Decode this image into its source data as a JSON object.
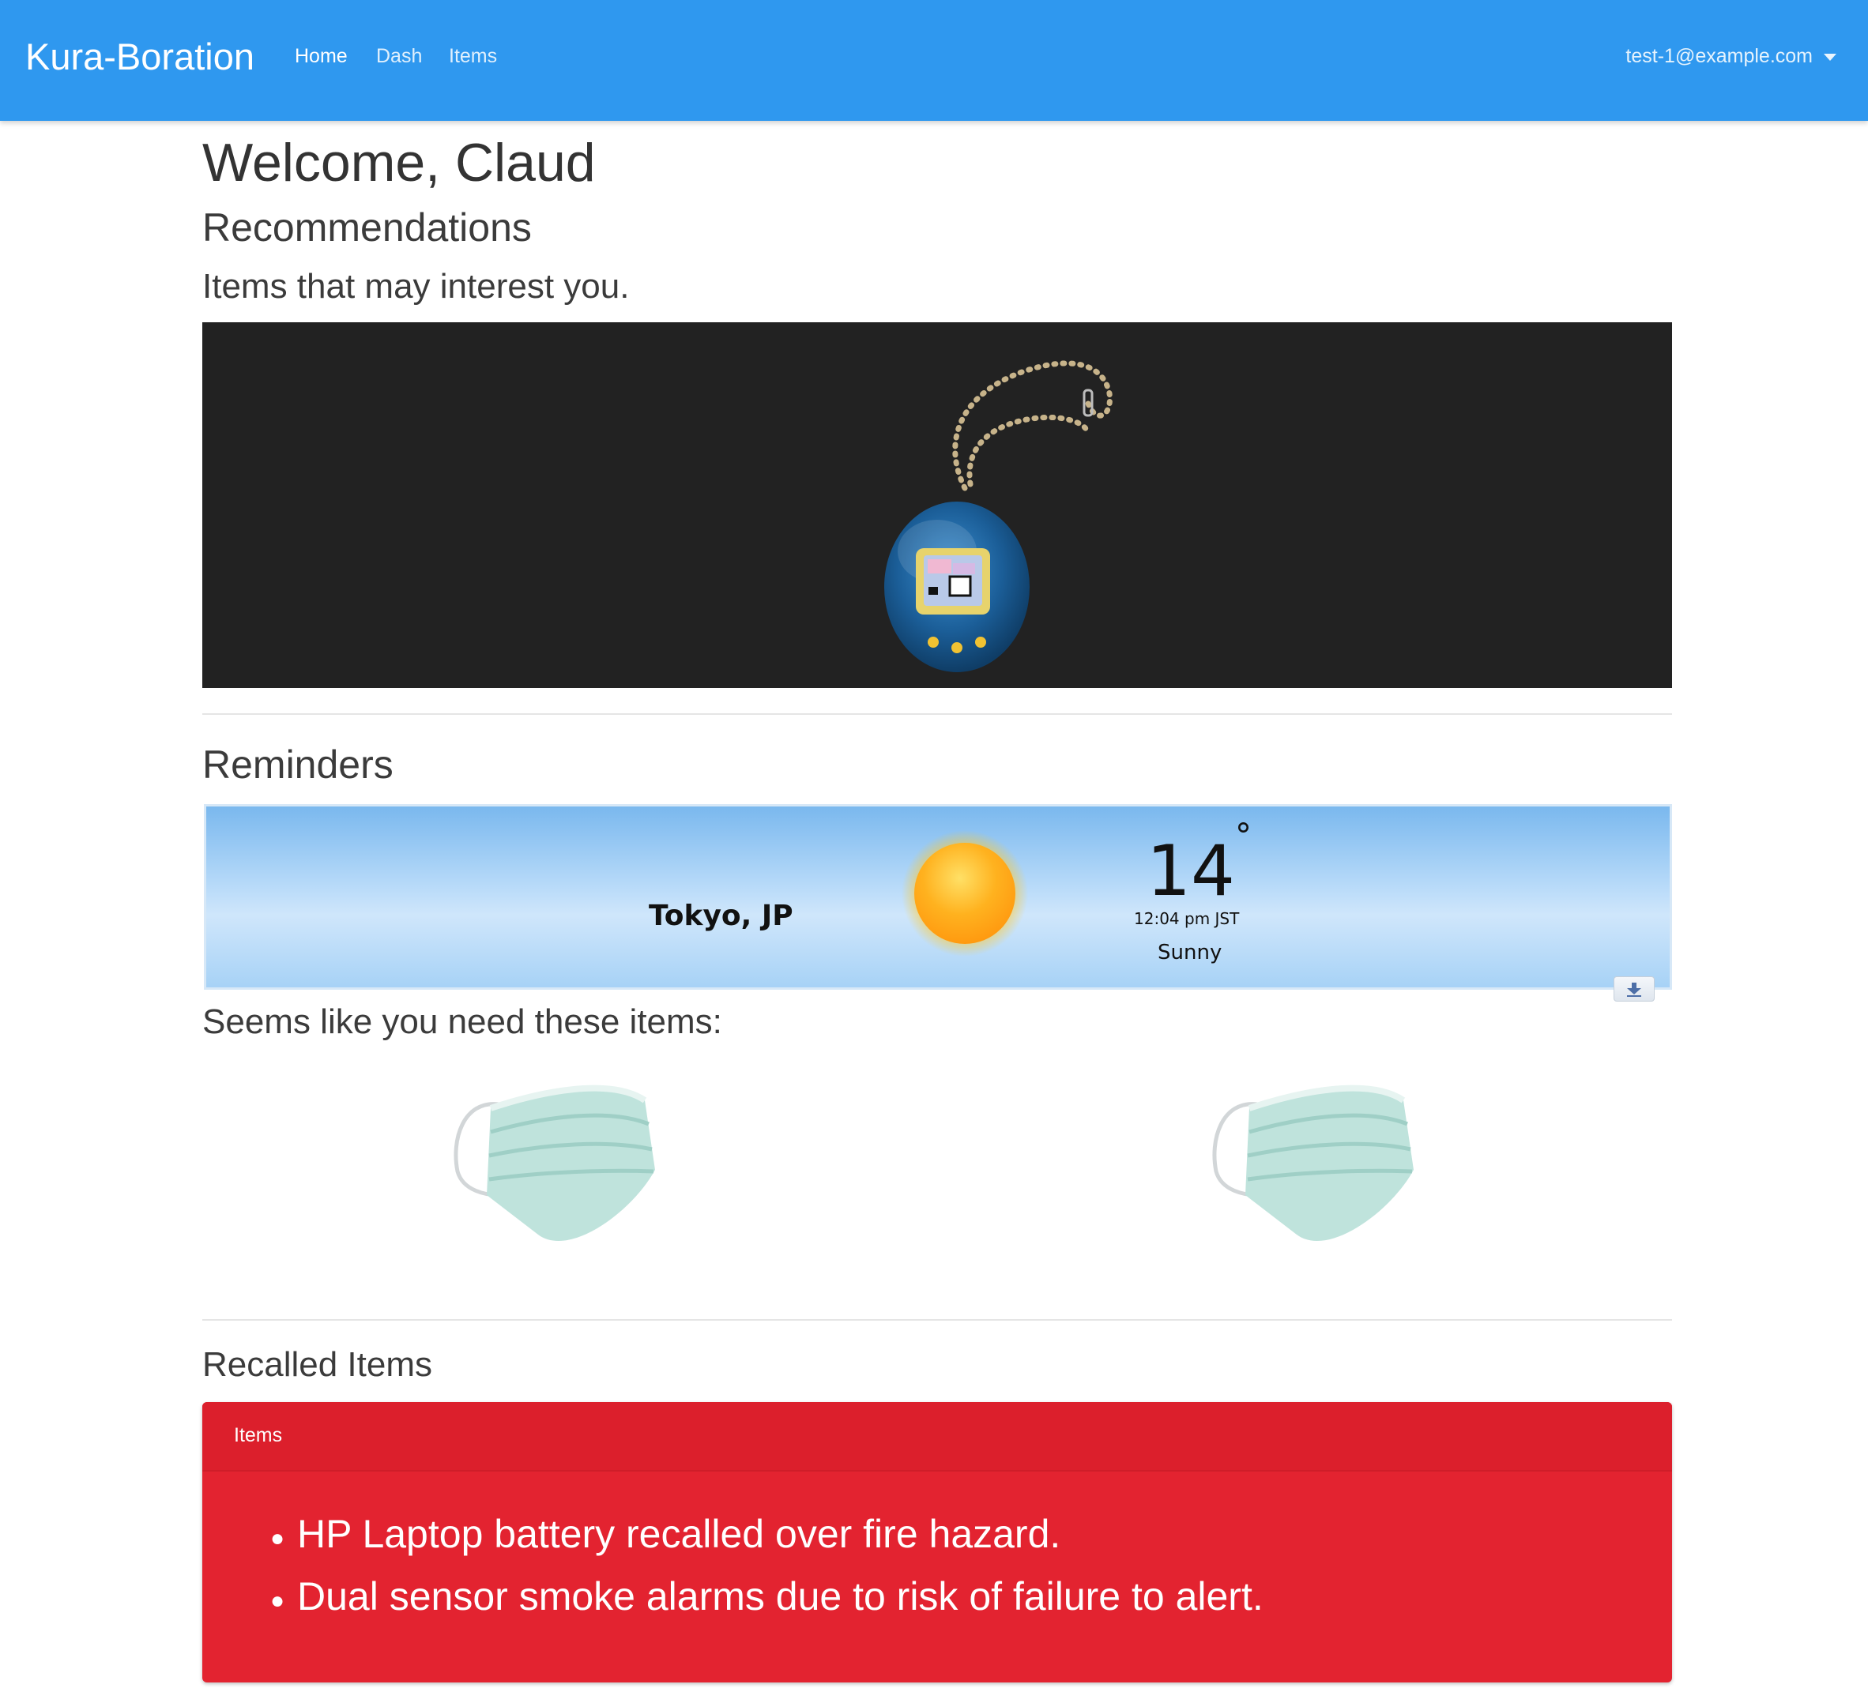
{
  "navbar": {
    "brand": "Kura-Boration",
    "links": [
      "Home",
      "Dash",
      "Items"
    ],
    "active_link": "Home",
    "user_email": "test-1@example.com"
  },
  "page": {
    "welcome": "Welcome, Claud",
    "recommendations_heading": "Recommendations",
    "recommendations_subheading": "Items that may interest you.",
    "carousel": {
      "slide_count": 3,
      "active_slide": 1
    },
    "reminders_heading": "Reminders",
    "weather": {
      "city": "Tokyo, JP",
      "temperature": "14",
      "degree_symbol": "°",
      "time": "12:04 pm JST",
      "condition": "Sunny"
    },
    "needed_items_heading": "Seems like you need these items:",
    "recalled_heading": "Recalled Items",
    "recall_card": {
      "header": "Items",
      "items": [
        "HP Laptop battery recalled over fire hazard.",
        "Dual sensor smoke alarms due to risk of failure to alert."
      ]
    }
  },
  "colors": {
    "navbar": "#2f98ef",
    "carousel_bg": "#222222",
    "recall_card": "#e32330"
  }
}
